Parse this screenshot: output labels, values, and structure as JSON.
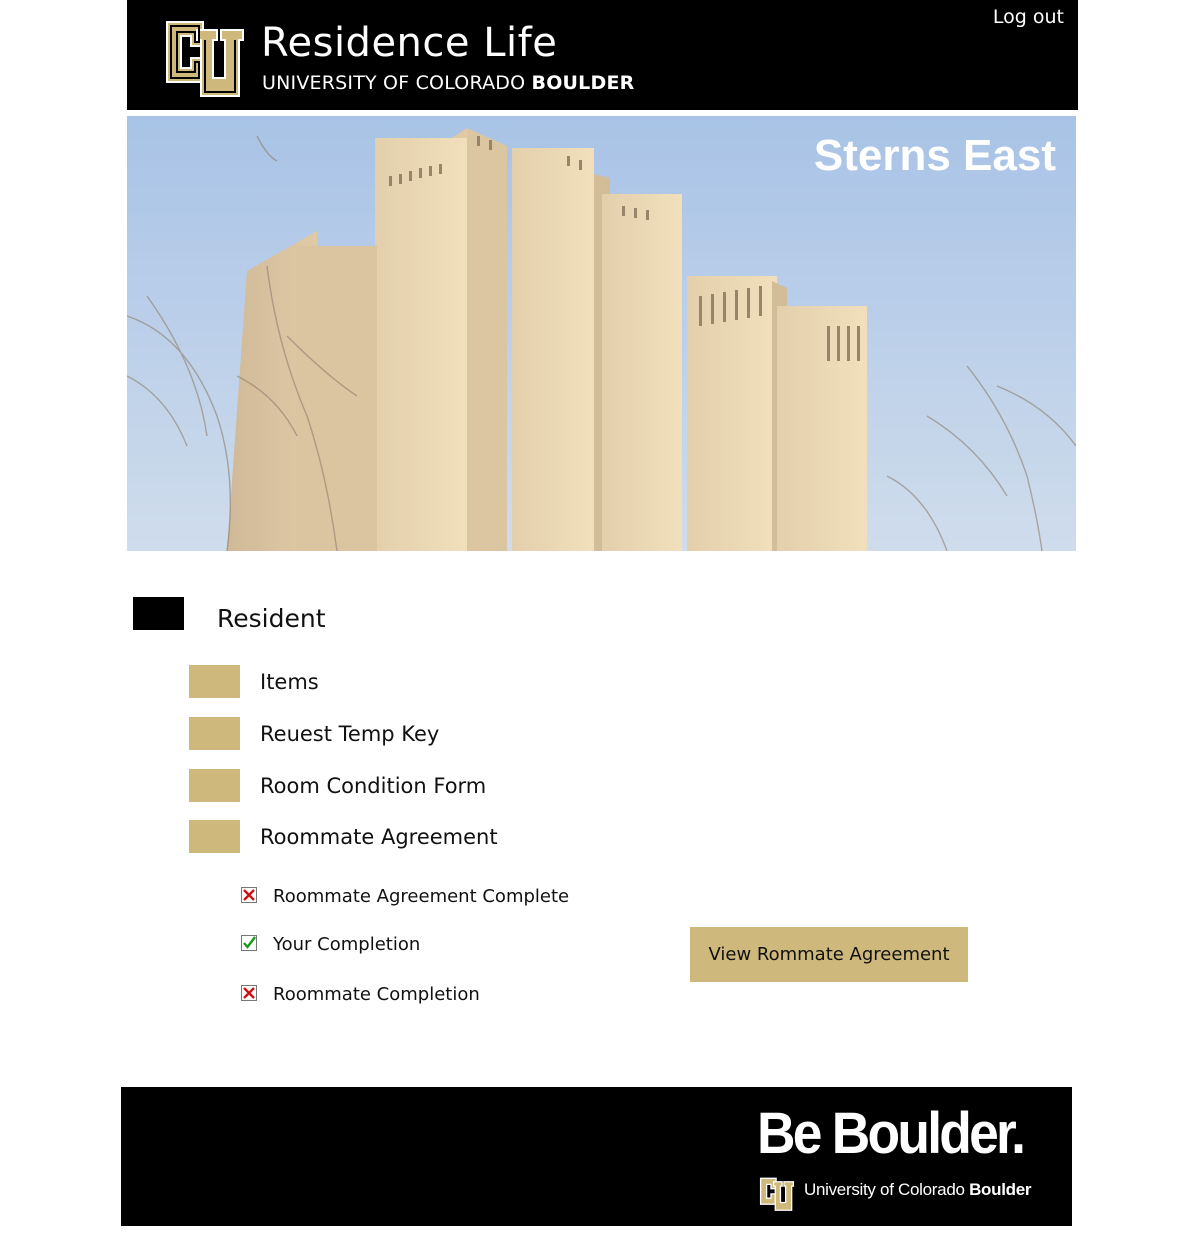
{
  "header": {
    "title": "Residence Life",
    "subtitle_prefix": "UNIVERSITY OF COLORADO ",
    "subtitle_bold": "BOULDER",
    "logout_label": "Log out"
  },
  "hero": {
    "building_name": "Sterns East"
  },
  "resident": {
    "section_title": "Resident",
    "menu": [
      {
        "label": "Items"
      },
      {
        "label": "Reuest Temp Key"
      },
      {
        "label": "Room Condition Form"
      },
      {
        "label": "Roommate Agreement"
      }
    ],
    "agreement_status": [
      {
        "label": "Roommate Agreement Complete",
        "status": "incomplete"
      },
      {
        "label": "Your Completion",
        "status": "complete"
      },
      {
        "label": "Roommate Completion",
        "status": "incomplete"
      }
    ],
    "view_button_label": "View Rommate Agreement"
  },
  "footer": {
    "slogan": "Be Boulder.",
    "univ_prefix": "University of Colorado ",
    "univ_bold": "Boulder"
  },
  "colors": {
    "brand_black": "#000000",
    "brand_gold": "#cfb87c",
    "check_green": "#1a9a1a",
    "cross_red": "#d01010"
  },
  "icons": {
    "logo": "cu-logo-icon",
    "complete": "checkmark-icon",
    "incomplete": "x-mark-icon"
  }
}
